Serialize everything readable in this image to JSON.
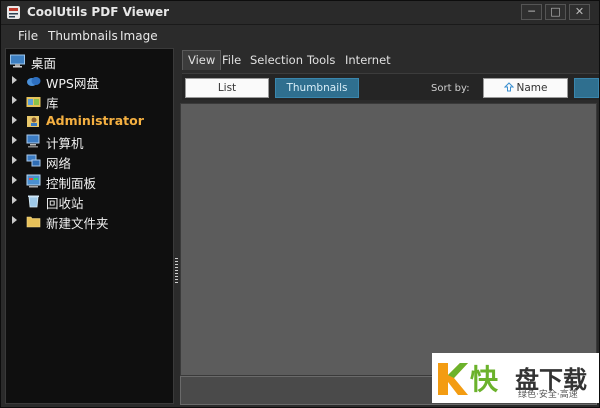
{
  "window": {
    "title": "CoolUtils PDF Viewer",
    "controls": {
      "minimize": "─",
      "maximize": "□",
      "close": "✕"
    }
  },
  "menubar": {
    "items": [
      "File",
      "Thumbnails",
      "Image"
    ]
  },
  "tree": {
    "root": {
      "label": "桌面",
      "icon": "desktop-icon"
    },
    "items": [
      {
        "label": "WPS网盘",
        "icon": "cloud-drive-icon",
        "active": false
      },
      {
        "label": "库",
        "icon": "library-icon",
        "active": false
      },
      {
        "label": "Administrator",
        "icon": "user-folder-icon",
        "active": true
      },
      {
        "label": "计算机",
        "icon": "computer-icon",
        "active": false
      },
      {
        "label": "网络",
        "icon": "network-icon",
        "active": false
      },
      {
        "label": "控制面板",
        "icon": "control-panel-icon",
        "active": false
      },
      {
        "label": "回收站",
        "icon": "recycle-bin-icon",
        "active": false
      },
      {
        "label": "新建文件夹",
        "icon": "folder-icon",
        "active": false
      }
    ]
  },
  "tabs": [
    "View",
    "File",
    "Selection",
    "Tools",
    "Internet"
  ],
  "active_tab": "View",
  "toolbar": {
    "list_label": "List",
    "thumbnails_label": "Thumbnails",
    "sort_label": "Sort by:",
    "name_label": "Name"
  },
  "watermark": {
    "kuai": "快",
    "main": "盘下载",
    "sub": "绿色·安全·高速"
  },
  "colors": {
    "accent": "#2f6f8f",
    "active_tree_item": "#f5b041",
    "watermark_green": "#6bb22b"
  }
}
